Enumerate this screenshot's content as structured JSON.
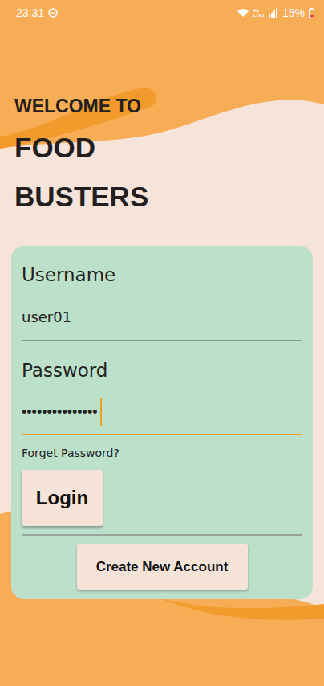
{
  "status_bar": {
    "time": "23:31",
    "volte": "Vo",
    "lte": "LTE1",
    "battery": "15%"
  },
  "title": {
    "line1": "WELCOME TO",
    "line2": "FOOD",
    "line3": "BUSTERS"
  },
  "form": {
    "username_label": "Username",
    "username_value": "user01",
    "password_label": "Password",
    "password_value": "•••••••••••••••",
    "password_focused": true,
    "forgot": "Forget Password?",
    "login": "Login",
    "create": "Create New Account"
  }
}
